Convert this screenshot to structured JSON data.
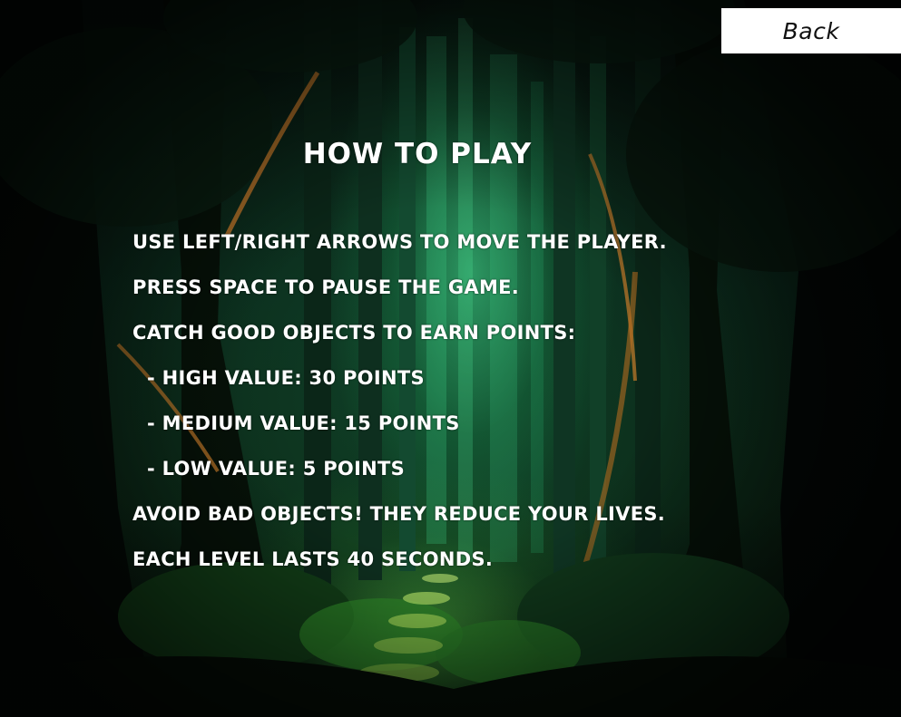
{
  "header": {
    "back_label": "Back"
  },
  "title": "HOW TO PLAY",
  "instructions": [
    "USE LEFT/RIGHT ARROWS TO MOVE THE PLAYER.",
    "PRESS SPACE TO PAUSE THE GAME.",
    "CATCH GOOD OBJECTS TO EARN POINTS:",
    "- HIGH VALUE: 30 POINTS",
    "- MEDIUM VALUE: 15 POINTS",
    "- LOW VALUE: 5 POINTS",
    "AVOID BAD OBJECTS! THEY REDUCE YOUR LIVES.",
    "EACH LEVEL LASTS 40 SECONDS."
  ],
  "colors": {
    "text": "#ffffff",
    "button_bg": "#ffffff",
    "button_text": "#111111",
    "forest_glow": "#3ee68f"
  }
}
